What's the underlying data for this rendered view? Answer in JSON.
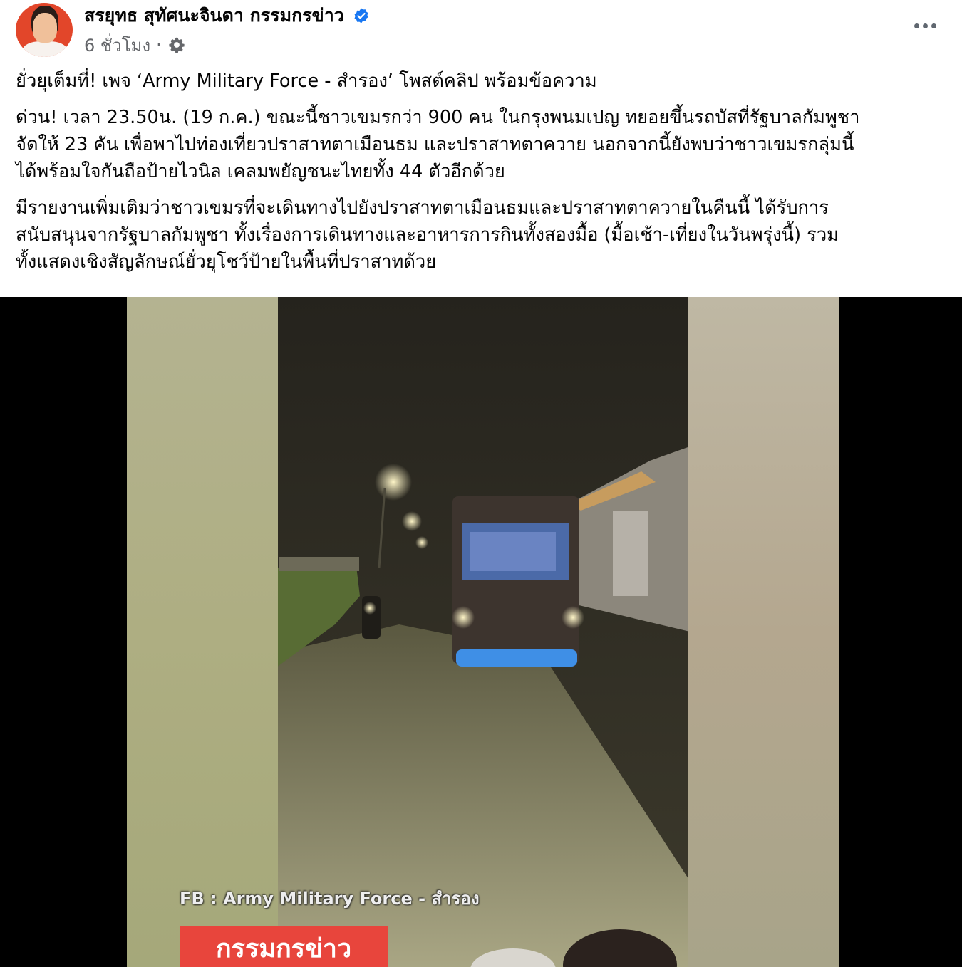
{
  "post": {
    "author": "สรยุทธ สุทัศนะจินดา กรรมกรข่าว",
    "time": "6 ชั่วโมง",
    "separator": "·",
    "paragraphs": [
      "ยั่วยุเต็มที่! เพจ ‘Army Military Force - สำรอง’ โพสต์คลิป พร้อมข้อความ",
      "ด่วน! เวลา 23.50น. (19 ก.ค.) ขณะนี้ชาวเขมรกว่า 900 คน ในกรุงพนมเปญ ทยอยขึ้นรถบัสที่รัฐบาลกัมพูชา\nจัดให้ 23 คัน เพื่อพาไปท่องเที่ยวปราสาทตาเมือนธม และปราสาทตาควาย นอกจากนี้ยังพบว่าชาวเขมรกลุ่มนี้\nได้พร้อมใจกันถือป้ายไวนิล เคลมพยัญชนะไทยทั้ง 44 ตัวอีกด้วย",
      "มีรายงานเพิ่มเติมว่าชาวเขมรที่จะเดินทางไปยังปราสาทตาเมือนธมและปราสาทตาควายในคืนนี้ ได้รับการ\nสนับสนุนจากรัฐบาลกัมพูชา ทั้งเรื่องการเดินทางและอาหารการกินทั้งสองมื้อ (มื้อเช้า-เที่ยงในวันพรุ่งนี้) รวม\nทั้งแสดงเชิงสัญลักษณ์ยั่วยุโชว์ป้ายในพื้นที่ปราสาทด้วย"
    ]
  },
  "video": {
    "watermark": "FB : Army Military Force - สำรอง",
    "label": "กรรมกรข่าว"
  },
  "icons": {
    "verified": "verified-badge-icon",
    "audience": "gear-icon",
    "more": "more-options-icon"
  },
  "colors": {
    "verified": "#1877f2",
    "meta_text": "#65676b",
    "news_label_bg": "#e8453c"
  }
}
